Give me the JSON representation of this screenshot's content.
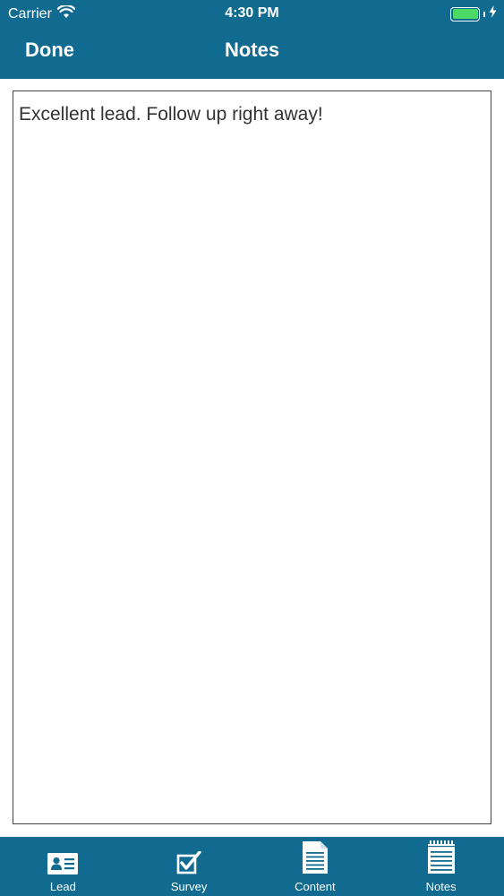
{
  "status_bar": {
    "carrier": "Carrier",
    "time": "4:30 PM",
    "battery_color": "#4cd964"
  },
  "nav": {
    "done_label": "Done",
    "title": "Notes"
  },
  "notes": {
    "text": "Excellent lead. Follow up right away!"
  },
  "tabs": [
    {
      "label": "Lead",
      "icon": "contact-card-icon"
    },
    {
      "label": "Survey",
      "icon": "checkbox-icon"
    },
    {
      "label": "Content",
      "icon": "document-icon"
    },
    {
      "label": "Notes",
      "icon": "notepad-icon"
    }
  ],
  "colors": {
    "brand": "#116b91",
    "text": "#333333"
  }
}
